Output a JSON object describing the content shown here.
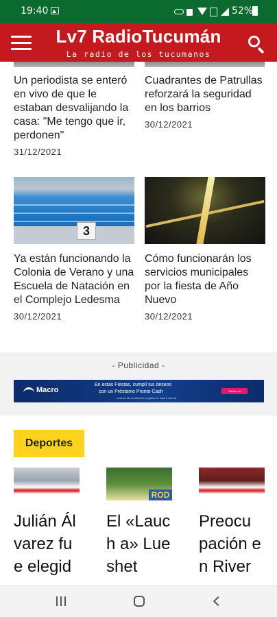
{
  "status_bar": {
    "time": "19:40",
    "battery": "52%",
    "icons": [
      "gallery-icon",
      "key-icon",
      "lock-icon",
      "wifi-icon",
      "sim-icon",
      "signal-icon",
      "battery-icon"
    ]
  },
  "header": {
    "title": "Lv7 RadioTucumán",
    "tagline": "La radio de los tucumanos",
    "menu_icon": "menu-icon",
    "search_icon": "search-icon",
    "background_color": "#c41a1f"
  },
  "articles": [
    {
      "headline": "Un periodista se enteró en vivo de que le estaban desvalijando la casa: \"Me tengo que ir, perdonen\"",
      "date": "31/12/2021"
    },
    {
      "headline": "Cuadrantes de Patrullas reforzará la seguridad en los barrios",
      "date": "30/12/2021"
    },
    {
      "headline": "Ya están funcionando la Colonia de Verano y una Escuela de Natación en el Complejo Ledesma",
      "date": "30/12/2021",
      "image_text": "3"
    },
    {
      "headline": "Cómo funcionarán los servicios municipales por la fiesta de Año Nuevo",
      "date": "30/12/2021"
    }
  ],
  "ad": {
    "label": "- Publicidad -",
    "brand": "Macro",
    "line1": "En estas Fiestas, cumplí tus deseos",
    "line2": "con un Préstamo Pronto Cash",
    "line3": "Conocé las condiciones legales en macro.com.ar",
    "button": "Sacalo ya"
  },
  "section": {
    "label": "Deportes",
    "color": "#ffd21f",
    "items": [
      {
        "headline": "Julián Álvarez fue elegido"
      },
      {
        "headline": "El «Lauch a» Lueshet",
        "image_text": "ROD"
      },
      {
        "headline": "Preocu pación en River por"
      }
    ]
  },
  "nav_bar": {
    "icons": [
      "recents-icon",
      "home-icon",
      "back-icon"
    ]
  }
}
